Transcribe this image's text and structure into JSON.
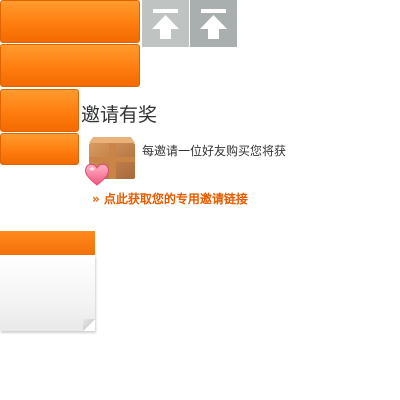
{
  "invite": {
    "title": "邀请有奖",
    "description": "每邀请一位好友购买您将获",
    "link_text": "» 点此获取您的专用邀请链接"
  },
  "icons": {
    "back_to_top": "arrow-up-to-line-icon",
    "gift": "gift-box-heart-icon"
  },
  "colors": {
    "accent": "#ff7d10",
    "link": "#e85c00",
    "button_gray_light": "#bfc4c2",
    "button_gray_dark": "#a9afae"
  }
}
